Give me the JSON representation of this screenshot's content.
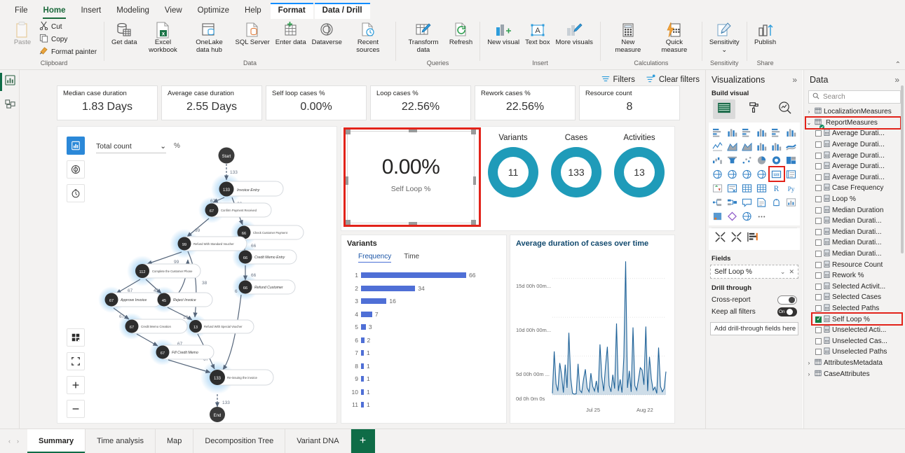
{
  "ribbon": {
    "tabs": [
      {
        "label": "File",
        "state": "normal"
      },
      {
        "label": "Home",
        "state": "active"
      },
      {
        "label": "Insert",
        "state": "normal"
      },
      {
        "label": "Modeling",
        "state": "normal"
      },
      {
        "label": "View",
        "state": "normal"
      },
      {
        "label": "Optimize",
        "state": "normal"
      },
      {
        "label": "Help",
        "state": "normal"
      },
      {
        "label": "Format",
        "state": "contextual"
      },
      {
        "label": "Data / Drill",
        "state": "contextual"
      }
    ],
    "groups": [
      {
        "label": "Clipboard",
        "buttons": [
          {
            "label": "Paste",
            "icon": "paste-icon",
            "disabled": true
          },
          {
            "label": "Cut",
            "icon": "cut-icon",
            "small": true
          },
          {
            "label": "Copy",
            "icon": "copy-icon",
            "small": true
          },
          {
            "label": "Format painter",
            "icon": "format-painter-icon",
            "small": true
          }
        ]
      },
      {
        "label": "Data",
        "buttons": [
          {
            "label": "Get data",
            "icon": "get-data-icon",
            "dropdown": true
          },
          {
            "label": "Excel workbook",
            "icon": "excel-workbook-icon"
          },
          {
            "label": "OneLake data hub",
            "icon": "onelake-data-hub-icon",
            "dropdown": true
          },
          {
            "label": "SQL Server",
            "icon": "sql-server-icon"
          },
          {
            "label": "Enter data",
            "icon": "enter-data-icon"
          },
          {
            "label": "Dataverse",
            "icon": "dataverse-icon"
          },
          {
            "label": "Recent sources",
            "icon": "recent-sources-icon",
            "dropdown": true
          }
        ]
      },
      {
        "label": "Queries",
        "buttons": [
          {
            "label": "Transform data",
            "icon": "transform-data-icon",
            "dropdown": true
          },
          {
            "label": "Refresh",
            "icon": "refresh-icon"
          }
        ]
      },
      {
        "label": "Insert",
        "buttons": [
          {
            "label": "New visual",
            "icon": "new-visual-icon"
          },
          {
            "label": "Text box",
            "icon": "text-box-icon"
          },
          {
            "label": "More visuals",
            "icon": "more-visuals-icon",
            "dropdown": true
          }
        ]
      },
      {
        "label": "Calculations",
        "buttons": [
          {
            "label": "New measure",
            "icon": "new-measure-icon"
          },
          {
            "label": "Quick measure",
            "icon": "quick-measure-icon"
          }
        ]
      },
      {
        "label": "Sensitivity",
        "buttons": [
          {
            "label": "Sensitivity",
            "icon": "sensitivity-icon",
            "dropdown": true
          }
        ]
      },
      {
        "label": "Share",
        "buttons": [
          {
            "label": "Publish",
            "icon": "publish-icon"
          }
        ]
      }
    ]
  },
  "left_rail": {
    "items": [
      {
        "name": "report-view",
        "icon": "report-view-icon",
        "selected": true
      },
      {
        "name": "model-view",
        "icon": "model-view-icon",
        "selected": false
      }
    ]
  },
  "canvas": {
    "filter_bar": [
      {
        "label": "Filters",
        "icon": "filter-icon"
      },
      {
        "label": "Clear filters",
        "icon": "clear-filters-icon"
      }
    ],
    "kpis": [
      {
        "title": "Median case duration",
        "value": "1.83 Days"
      },
      {
        "title": "Average case duration",
        "value": "2.55 Days"
      },
      {
        "title": "Self loop cases %",
        "value": "0.00%"
      },
      {
        "title": "Loop cases %",
        "value": "22.56%"
      },
      {
        "title": "Rework cases %",
        "value": "22.56%"
      },
      {
        "title": "Resource count",
        "value": "8"
      }
    ],
    "process_map": {
      "metric_dropdown": {
        "value": "Total count"
      },
      "percent_label": "%",
      "left_tools": [
        {
          "name": "frequency-view-tool",
          "icon": "frequency-icon",
          "selected": true
        },
        {
          "name": "performance-view-tool",
          "icon": "target-icon",
          "selected": false
        },
        {
          "name": "duration-view-tool",
          "icon": "stopwatch-icon",
          "selected": false
        }
      ],
      "bottom_tools": [
        {
          "name": "layout-tool",
          "icon": "grid-layout-icon"
        },
        {
          "name": "fit-screen-tool",
          "icon": "fit-screen-icon"
        },
        {
          "name": "zoom-in-tool",
          "icon": "plus-icon"
        },
        {
          "name": "zoom-out-tool",
          "icon": "minus-icon"
        }
      ],
      "nodes": [
        {
          "id": "start",
          "label": "Start",
          "count": "",
          "type": "terminal"
        },
        {
          "id": "invoice-entry",
          "label": "Invoice Entry",
          "count": "133"
        },
        {
          "id": "confirm-payment-received",
          "label": "Confirm Payment Received",
          "count": "67"
        },
        {
          "id": "check-customer-payment",
          "label": "Check Customer Payment",
          "count": "66"
        },
        {
          "id": "refund-with-standard-voucher",
          "label": "Refund With Standard Voucher",
          "count": "99"
        },
        {
          "id": "credit-memo-entry",
          "label": "Credit Memo Entry",
          "count": "66"
        },
        {
          "id": "complete-the-customer-phone",
          "label": "Complete the Customer Phone",
          "count": "112"
        },
        {
          "id": "refund-customer",
          "label": "Refund Customer",
          "count": "66"
        },
        {
          "id": "approve-invoice",
          "label": "Approve Invoice",
          "count": "67"
        },
        {
          "id": "reject-invoice",
          "label": "Reject Invoice",
          "count": "45"
        },
        {
          "id": "credit-memo-creation",
          "label": "Credit Memo Creation",
          "count": "67"
        },
        {
          "id": "refund-with-special-voucher",
          "label": "Refund With Special Voucher",
          "count": "13"
        },
        {
          "id": "fill-credit-memo",
          "label": "Fill Credit Memo",
          "count": "67"
        },
        {
          "id": "re-issuing-the-invoice",
          "label": "Re-issuing the invoice",
          "count": "133"
        },
        {
          "id": "end",
          "label": "End",
          "count": "",
          "type": "terminal"
        }
      ],
      "edge_labels": [
        "133",
        "67",
        "66",
        "99",
        "66",
        "38",
        "45",
        "6",
        "66",
        "13",
        "67",
        "7",
        "67",
        "67",
        "133"
      ]
    },
    "self_loop_card": {
      "value": "0.00%",
      "label": "Self Loop %",
      "selected": true,
      "highlight_color": "#e2231a"
    },
    "donuts": [
      {
        "title": "Variants",
        "value": "11"
      },
      {
        "title": "Cases",
        "value": "133"
      },
      {
        "title": "Activities",
        "value": "13"
      }
    ],
    "variants_panel": {
      "title": "Variants",
      "tabs": [
        {
          "label": "Frequency",
          "selected": true
        },
        {
          "label": "Time",
          "selected": false
        }
      ]
    },
    "line_panel": {
      "title": "Average duration of cases over time"
    }
  },
  "chart_data": [
    {
      "type": "bar",
      "title": "Variants",
      "orientation": "horizontal",
      "categories": [
        "1",
        "2",
        "3",
        "4",
        "5",
        "6",
        "7",
        "8",
        "9",
        "10",
        "11"
      ],
      "values": [
        66,
        34,
        16,
        7,
        3,
        2,
        1,
        1,
        1,
        1,
        1
      ],
      "xlabel": "",
      "ylabel": "",
      "xlim": [
        0,
        66
      ],
      "grid": false,
      "legend": "none",
      "series_color": "#4f6fd6",
      "data_labels": [
        "66",
        "34",
        "16",
        "7",
        "3",
        "2",
        "1",
        "1",
        "1",
        "1",
        "1"
      ]
    },
    {
      "type": "area",
      "title": "Average duration of cases over time",
      "xlabel": "",
      "ylabel": "",
      "y_ticks": [
        "0d 0h 0m 0s",
        "5d 00h 00m ...",
        "10d 00h 00m...",
        "15d 00h 00m..."
      ],
      "y_tick_values": [
        0,
        5,
        10,
        15
      ],
      "ylim": [
        0,
        17.5
      ],
      "x_ticks": [
        "Jul 25",
        "Aug 22"
      ],
      "grid": true,
      "legend": "none",
      "series_color": "#1f6298",
      "values": [
        0.2,
        5.6,
        1.4,
        0.5,
        4.1,
        2.6,
        0.3,
        3.9,
        0.9,
        8.0,
        2.2,
        0.2,
        0.1,
        0.15,
        4.0,
        0.6,
        0.3,
        2.0,
        3.3,
        0.9,
        0.4,
        2.8,
        1.1,
        0.5,
        1.8,
        0.3,
        6.5,
        2.3,
        0.5,
        3.7,
        6.2,
        1.2,
        0.4,
        2.6,
        0.8,
        9.2,
        0.5,
        2.0,
        0.3,
        4.8,
        17.2,
        0.9,
        3.1,
        0.4,
        8.7,
        1.2,
        0.6,
        2.0,
        3.5,
        3.2,
        1.3,
        8.8,
        0.5,
        4.9,
        2.1,
        0.6,
        1.0,
        0.2,
        6.1,
        1.1,
        0.4,
        0.8,
        3.0
      ]
    }
  ],
  "visualizations_pane": {
    "title": "Visualizations",
    "collapse_icon": "chevrons-right-icon",
    "build_visual_label": "Build visual",
    "build_tabs": [
      {
        "name": "build-visual-tab",
        "icon": "build-visual-icon",
        "selected": true
      },
      {
        "name": "format-visual-tab",
        "icon": "paint-roller-icon",
        "selected": false
      },
      {
        "name": "analytics-tab",
        "icon": "analytics-magnifier-icon",
        "selected": false
      }
    ],
    "gallery_icons": [
      "stacked-bar-chart-icon",
      "stacked-column-chart-icon",
      "clustered-bar-chart-icon",
      "clustered-column-chart-icon",
      "100-stacked-bar-chart-icon",
      "100-stacked-column-chart-icon",
      "line-chart-icon",
      "area-chart-icon",
      "stacked-area-chart-icon",
      "line-stacked-column-icon",
      "line-clustered-column-icon",
      "ribbon-chart-icon",
      "waterfall-chart-icon",
      "funnel-chart-icon",
      "scatter-chart-icon",
      "pie-chart-icon",
      "donut-chart-icon",
      "treemap-icon",
      "map-icon",
      "filled-map-icon",
      "shape-map-icon",
      "azure-map-icon",
      "card-icon",
      "multi-row-card-icon",
      "kpi-icon",
      "slicer-icon",
      "table-icon",
      "matrix-icon",
      "r-script-visual-icon",
      "python-visual-icon",
      "decomposition-tree-icon",
      "key-influencers-icon",
      "smart-narrative-icon",
      "paginated-report-icon",
      "q-and-a-icon",
      "metrics-icon",
      "power-apps-icon",
      "power-automate-icon",
      "arcgis-maps-icon",
      "more-options-icon"
    ],
    "highlighted_gallery_icon": "card-icon",
    "gallery_row2_icons": [
      "build-tools-icon",
      "format-tools-icon",
      "get-more-visuals-icon"
    ],
    "fields_label": "Fields",
    "field_well": {
      "value": "Self Loop %",
      "chevron": "chevron-down-icon",
      "remove": "close-icon"
    },
    "drill_through_label": "Drill through",
    "drill_rows": [
      {
        "label": "Cross-report",
        "state": "Off",
        "on": false
      },
      {
        "label": "Keep all filters",
        "state": "On",
        "on": true
      }
    ],
    "drop_zone": "Add drill-through fields here"
  },
  "data_pane": {
    "title": "Data",
    "collapse_icon": "chevrons-right-icon",
    "search_placeholder": "Search",
    "search_icon": "search-icon",
    "tree": [
      {
        "label": "LocalizationMeasures",
        "type": "table",
        "expanded": false,
        "level": 0
      },
      {
        "label": "ReportMeasures",
        "type": "table",
        "expanded": true,
        "level": 0,
        "highlighted": true,
        "badge": "check-badge-icon"
      },
      {
        "label": "Average Durati...",
        "type": "measure",
        "level": 1,
        "checked": false
      },
      {
        "label": "Average Durati...",
        "type": "measure",
        "level": 1,
        "checked": false
      },
      {
        "label": "Average Durati...",
        "type": "measure",
        "level": 1,
        "checked": false
      },
      {
        "label": "Average Durati...",
        "type": "measure",
        "level": 1,
        "checked": false
      },
      {
        "label": "Average Durati...",
        "type": "measure",
        "level": 1,
        "checked": false
      },
      {
        "label": "Case Frequency",
        "type": "measure",
        "level": 1,
        "checked": false
      },
      {
        "label": "Loop %",
        "type": "measure",
        "level": 1,
        "checked": false
      },
      {
        "label": "Median Duration",
        "type": "measure",
        "level": 1,
        "checked": false
      },
      {
        "label": "Median Durati...",
        "type": "measure",
        "level": 1,
        "checked": false
      },
      {
        "label": "Median Durati...",
        "type": "measure",
        "level": 1,
        "checked": false
      },
      {
        "label": "Median Durati...",
        "type": "measure",
        "level": 1,
        "checked": false
      },
      {
        "label": "Median Durati...",
        "type": "measure",
        "level": 1,
        "checked": false
      },
      {
        "label": "Resource Count",
        "type": "measure",
        "level": 1,
        "checked": false
      },
      {
        "label": "Rework %",
        "type": "measure",
        "level": 1,
        "checked": false
      },
      {
        "label": "Selected Activit...",
        "type": "measure",
        "level": 1,
        "checked": false
      },
      {
        "label": "Selected Cases",
        "type": "measure",
        "level": 1,
        "checked": false
      },
      {
        "label": "Selected Paths",
        "type": "measure",
        "level": 1,
        "checked": false
      },
      {
        "label": "Self Loop %",
        "type": "measure",
        "level": 1,
        "checked": true,
        "highlighted": true
      },
      {
        "label": "Unselected Acti...",
        "type": "measure",
        "level": 1,
        "checked": false
      },
      {
        "label": "Unselected Cas...",
        "type": "measure",
        "level": 1,
        "checked": false
      },
      {
        "label": "Unselected Paths",
        "type": "measure",
        "level": 1,
        "checked": false
      },
      {
        "label": "AttributesMetadata",
        "type": "table",
        "expanded": false,
        "level": 0
      },
      {
        "label": "CaseAttributes",
        "type": "table",
        "expanded": false,
        "level": 0
      }
    ]
  },
  "page_tabs": {
    "nav_prev": "‹",
    "nav_next": "›",
    "tabs": [
      {
        "label": "Summary",
        "selected": true
      },
      {
        "label": "Time analysis",
        "selected": false
      },
      {
        "label": "Map",
        "selected": false
      },
      {
        "label": "Decomposition Tree",
        "selected": false
      },
      {
        "label": "Variant DNA",
        "selected": false
      }
    ],
    "add_label": "+"
  },
  "colors": {
    "accent_green": "#0f6c47",
    "donut_teal": "#1f9bb9",
    "variant_blue": "#4f6fd6",
    "line_blue": "#1f6298",
    "highlight_red": "#e2231a",
    "ribbon_bg": "#f3f2f1"
  }
}
